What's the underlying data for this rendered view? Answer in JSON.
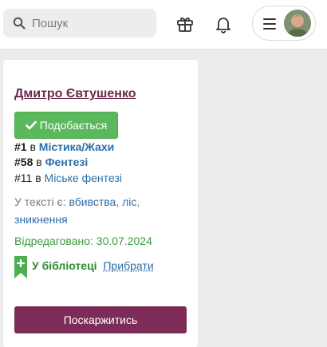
{
  "header": {
    "search": {
      "placeholder": "Пошук",
      "value": ""
    },
    "icons": {
      "search": "search-icon",
      "gift": "gift-icon",
      "bell": "bell-icon",
      "menu": "hamburger-icon"
    }
  },
  "book": {
    "author": "Дмитро Євтушенко",
    "like_label": "Подобається",
    "rankings": [
      {
        "position": "#1",
        "connector": "в",
        "category": "Містика/Жахи"
      },
      {
        "position": "#58",
        "connector": "в",
        "category": "Фентезі"
      },
      {
        "position": "#11",
        "connector": "в",
        "category": "Міське фентезі"
      }
    ],
    "tags_label": "У тексті є:",
    "tags": [
      "вбивства",
      "ліс",
      "зникнення"
    ],
    "edited": "Відредаговано: 30.07.2024",
    "library_status": "У бібліотеці",
    "remove_label": "Прибрати",
    "report_label": "Поскаржитись"
  },
  "colors": {
    "author": "#6a2a4c",
    "like": "#5cb85c",
    "link": "#2c6ea8",
    "edited": "#3a9a3a",
    "report": "#7d2c58"
  }
}
